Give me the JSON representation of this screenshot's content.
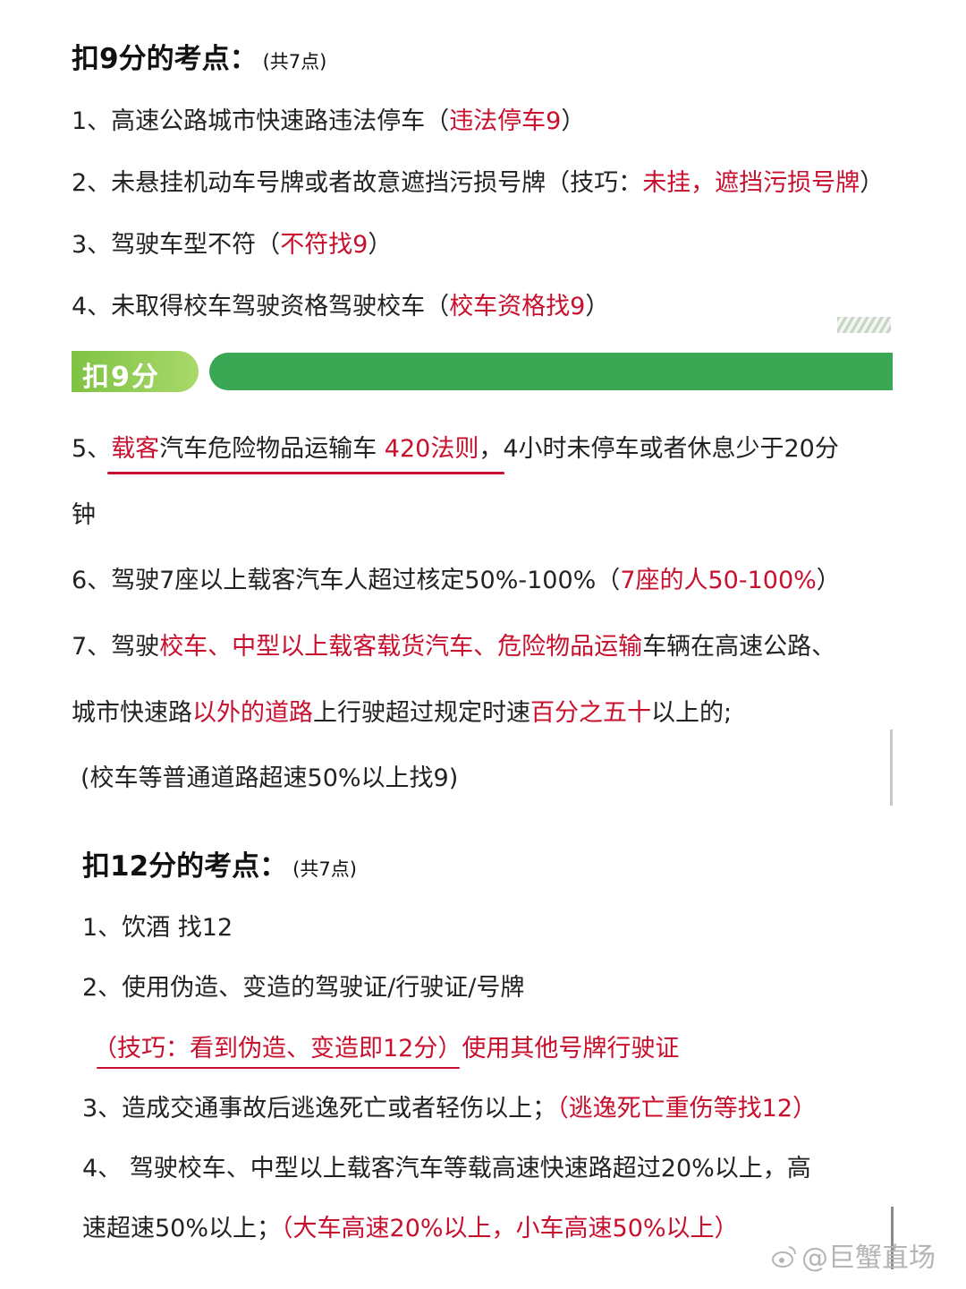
{
  "section9": {
    "heading": "扣9分的考点：",
    "count": "(共7点)",
    "items": [
      {
        "text": "1、高速公路城市快速路违法停车（",
        "tip": "违法停车9",
        "close": "）"
      },
      {
        "text": "2、未悬挂机动车号牌或者故意遮挡污损号牌（技巧：",
        "tip": "未挂，遮挡污损号牌",
        "close": "）"
      },
      {
        "text": "3、驾驶车型不符（",
        "tip": "不符找9",
        "close": "）"
      },
      {
        "text": "4、未取得校车驾驶资格驾驶校车（",
        "tip": "校车资格找9",
        "close": "）"
      }
    ]
  },
  "banner": {
    "label": "扣9分"
  },
  "section9b": {
    "item5_num": "5、",
    "item5_red1": "载客",
    "item5_mid": "汽车危险物品运输车 ",
    "item5_red2": "420法则",
    "item5_rest": "，4小时未停车或者休息少于20分",
    "item5_wrap": "钟",
    "item6_text": "6、驾驶7座以上载客汽车人超过核定50%-100%（",
    "item6_tip": "7座的人50-100%",
    "item6_close": "）",
    "item7_num": "7、驾驶",
    "item7_red1": "校车、中型以上载客载货汽车、危险物品运输",
    "item7_mid": "车辆在高速公路、",
    "item7_line2_a": "城市快速路",
    "item7_line2_red": "以外的道路",
    "item7_line2_b": "上行驶超过规定时速",
    "item7_line2_red2": "百分之五十",
    "item7_line2_c": "以上的;",
    "item7_note": "(校车等普通道路超速50%以上找9)"
  },
  "section12": {
    "heading": "扣12分的考点：",
    "count": "(共7点)",
    "item1": "1、饮酒 找12",
    "item2": "2、使用伪造、变造的驾驶证/行驶证/号牌",
    "item2_tip": "（技巧：看到伪造、变造即12分）使用其他号牌行驶证",
    "item3_text": "3、造成交通事故后逃逸死亡或者轻伤以上；",
    "item3_tip": "（逃逸死亡重伤等找12）",
    "item4_line1": "4、 驾驶校车、中型以上载客汽车等载高速快速路超过20%以上，高",
    "item4_line2": "速超速50%以上；",
    "item4_tip": "（大车高速20%以上，小车高速50%以上）"
  },
  "watermark": "@巨蟹直场"
}
